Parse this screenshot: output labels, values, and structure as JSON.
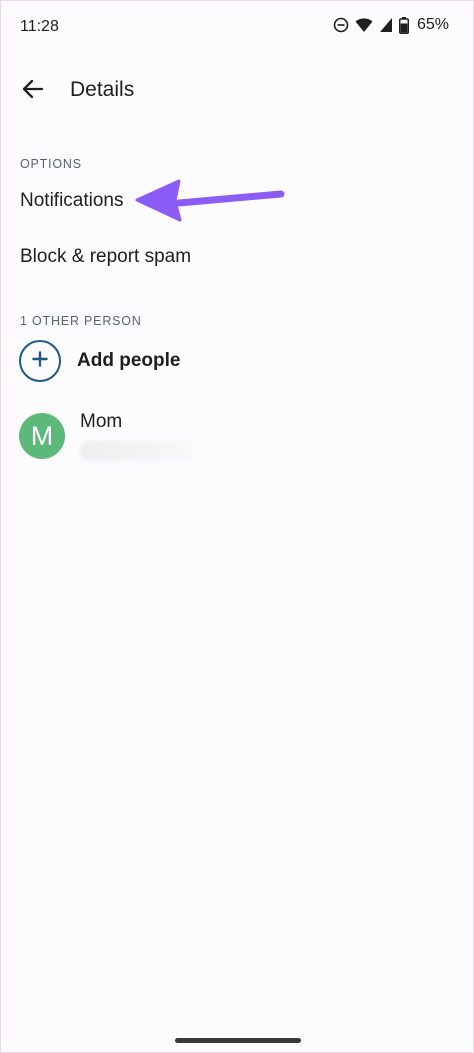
{
  "status_bar": {
    "time": "11:28",
    "icons": [
      "do-not-disturb-icon",
      "wifi-icon",
      "signal-icon",
      "battery-icon"
    ],
    "battery_percent": "65%"
  },
  "app_bar": {
    "back_icon": "arrow-left-icon",
    "title": "Details"
  },
  "options": {
    "header": "OPTIONS",
    "items": [
      {
        "label": "Notifications"
      },
      {
        "label": "Block & report spam"
      }
    ]
  },
  "people": {
    "header": "1 OTHER PERSON",
    "add_label": "Add people",
    "add_icon": "plus-icon",
    "contacts": [
      {
        "initial": "M",
        "name": "Mom",
        "avatar_color": "#5cb97a"
      }
    ]
  },
  "annotation": {
    "arrow_color": "#8b5cf6"
  },
  "colors": {
    "background": "#fcfbfe",
    "accent_ring": "#1e5a7e"
  }
}
